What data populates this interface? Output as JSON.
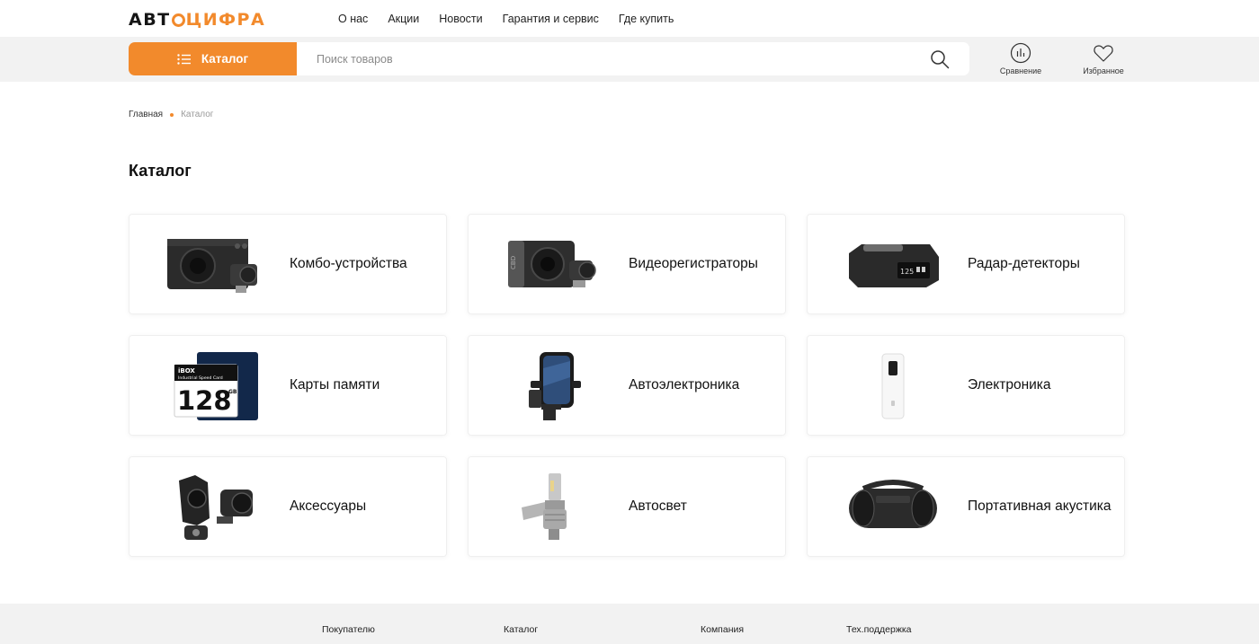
{
  "brand": {
    "logo_left": "АВТ",
    "logo_right": "ЦИФРА",
    "accent": "#f28a2c"
  },
  "topnav": [
    "О нас",
    "Акции",
    "Новости",
    "Гарантия и сервис",
    "Где купить"
  ],
  "header": {
    "catalog_label": "Каталог",
    "search_placeholder": "Поиск товаров",
    "compare_label": "Сравнение",
    "favorites_label": "Избранное"
  },
  "breadcrumb": {
    "home": "Главная",
    "current": "Каталог"
  },
  "page_title": "Каталог",
  "categories": [
    {
      "label": "Комбо-устройства",
      "icon": "combo-device-icon"
    },
    {
      "label": "Видеорегистраторы",
      "icon": "dashcam-icon"
    },
    {
      "label": "Радар-детекторы",
      "icon": "radar-detector-icon"
    },
    {
      "label": "Карты памяти",
      "icon": "memory-card-icon"
    },
    {
      "label": "Автоэлектроника",
      "icon": "phone-holder-icon"
    },
    {
      "label": "Электроника",
      "icon": "powerbank-icon"
    },
    {
      "label": "Аксессуары",
      "icon": "camera-accessory-icon"
    },
    {
      "label": "Автосвет",
      "icon": "headlight-bulb-icon"
    },
    {
      "label": "Портативная акустика",
      "icon": "speaker-icon"
    }
  ],
  "memory_card": {
    "brand": "iBOX",
    "subtitle": "Industrial Speed Card",
    "size": "128",
    "unit": "GB"
  },
  "footer": [
    "Покупателю",
    "Каталог",
    "Компания",
    "Тех.поддержка"
  ]
}
